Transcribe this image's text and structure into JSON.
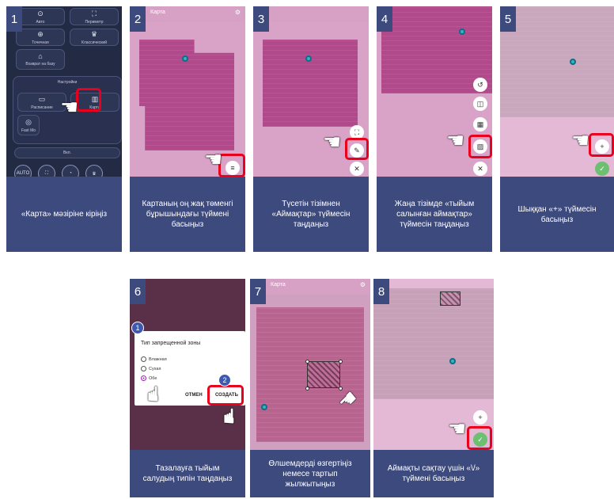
{
  "steps": [
    {
      "number": "1",
      "caption": "«Карта» мәзіріне кіріңіз",
      "tiles": [
        "Авто",
        "Периметр",
        "Точечная",
        "Классический",
        "Возврат на базу"
      ],
      "settings_title": "Настройки",
      "settings_items": [
        "Расписание",
        "Карта",
        "Fast Mo"
      ],
      "toggle_label": "Вкл.",
      "mode_labels": [
        "AUTO"
      ]
    },
    {
      "number": "2",
      "caption": "Картаның оң жақ төменгі бұрышындағы түймені басыңыз",
      "header_title": "Карта"
    },
    {
      "number": "3",
      "caption": "Түсетін тізімнен «Аймақтар» түймесін таңдаңыз"
    },
    {
      "number": "4",
      "caption": "Жаңа тізімде «тыйым салынған аймақтар» түймесін таңдаңыз"
    },
    {
      "number": "5",
      "caption": "Шыққан «+» түймесін басыңыз"
    },
    {
      "number": "6",
      "caption": "Тазалауға тыйым салудың типін таңдаңыз",
      "dialog_title": "Тип запрещенной зоны",
      "options": [
        "Влажная",
        "Сухая",
        "Обе"
      ],
      "selected_option": "Обе",
      "cancel_label": "ОТМЕН",
      "create_label": "СОЗДАТЬ",
      "badges": [
        "1",
        "2"
      ]
    },
    {
      "number": "7",
      "caption": "Өлшемдерді өзгертіңіз немесе тартып жылжытыңыз",
      "header_title": "Карта"
    },
    {
      "number": "8",
      "caption": "Аймақты сақтау үшін «\\/» түймені басыңыз"
    }
  ],
  "colors": {
    "caption_bg": "#3d4a7d",
    "highlight": "#e8001c",
    "map": "#b04a8b",
    "confirm": "#6fbf73"
  },
  "icons": [
    "pointing-hand-icon",
    "gear-icon",
    "dock-icon",
    "plus-icon",
    "check-icon",
    "close-icon",
    "edit-icon",
    "menu-icon"
  ]
}
